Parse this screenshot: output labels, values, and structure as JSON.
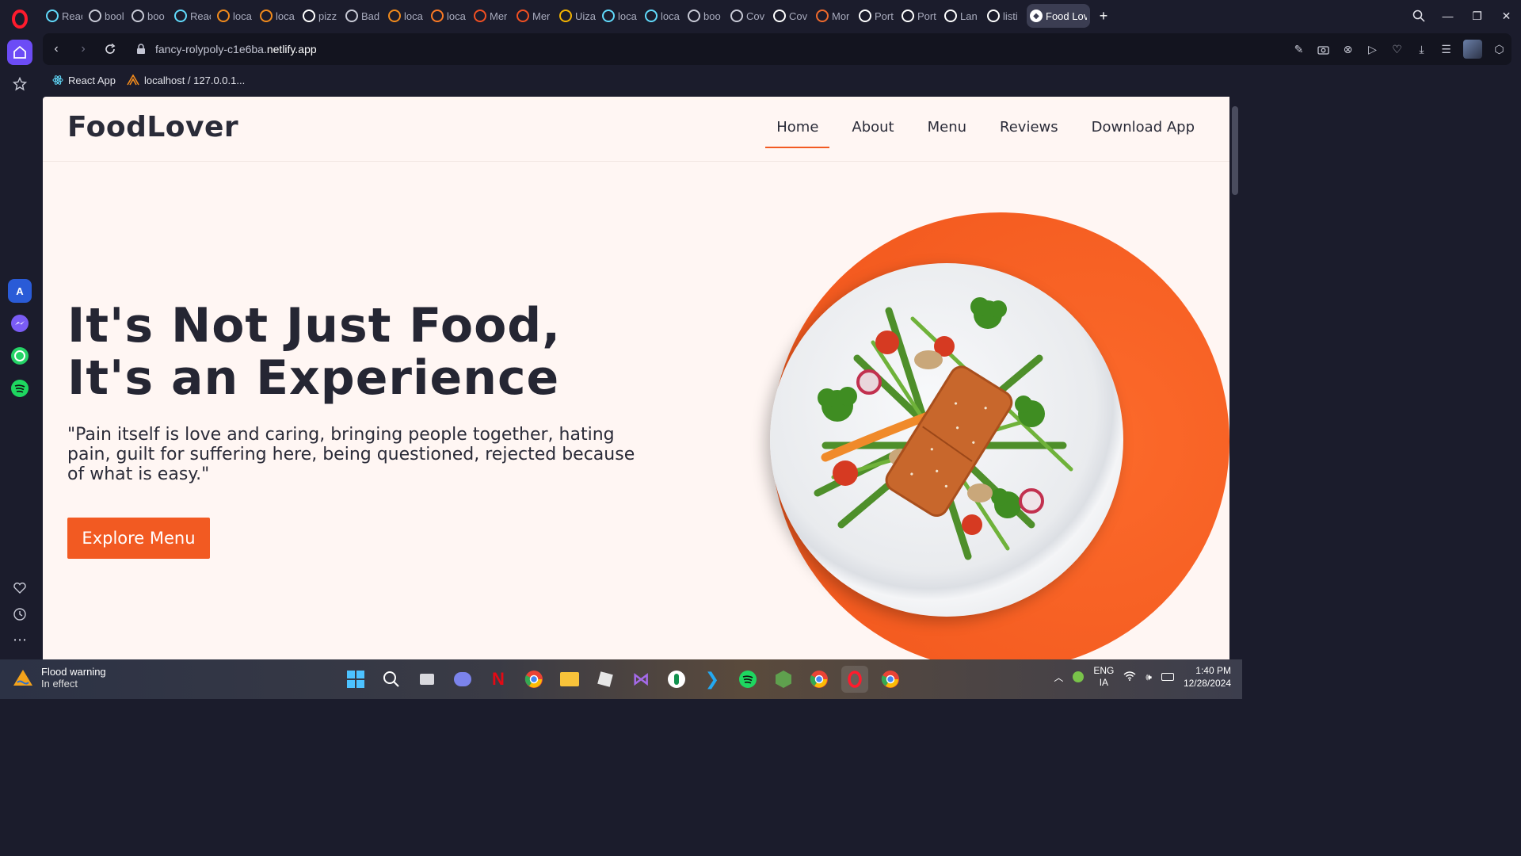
{
  "browser": {
    "tabs": [
      {
        "label": "Reac",
        "icon": "react-icon",
        "color": "#61dafb"
      },
      {
        "label": "bool",
        "icon": "page-icon",
        "color": "#c8cad6"
      },
      {
        "label": "boo",
        "icon": "page-icon",
        "color": "#c8cad6"
      },
      {
        "label": "Reac",
        "icon": "react-icon",
        "color": "#61dafb"
      },
      {
        "label": "loca",
        "icon": "xampp-icon",
        "color": "#f28b1c"
      },
      {
        "label": "loca",
        "icon": "xampp-icon",
        "color": "#f28b1c"
      },
      {
        "label": "pizz",
        "icon": "google-icon",
        "color": "#ffffff"
      },
      {
        "label": "Bad",
        "icon": "page-icon",
        "color": "#c8cad6"
      },
      {
        "label": "loca",
        "icon": "xampp-icon",
        "color": "#f28b1c"
      },
      {
        "label": "loca",
        "icon": "xampp-x-icon",
        "color": "#fb7a24"
      },
      {
        "label": "Mer",
        "icon": "microsoft-icon",
        "color": "#f25022"
      },
      {
        "label": "Mer",
        "icon": "microsoft-icon",
        "color": "#f25022"
      },
      {
        "label": "Uiza",
        "icon": "uiza-icon",
        "color": "#f5b400"
      },
      {
        "label": "loca",
        "icon": "react-icon",
        "color": "#61dafb"
      },
      {
        "label": "loca",
        "icon": "react-icon",
        "color": "#61dafb"
      },
      {
        "label": "boo",
        "icon": "page-icon",
        "color": "#c8cad6"
      },
      {
        "label": "Cov",
        "icon": "page-icon",
        "color": "#c8cad6"
      },
      {
        "label": "Cov",
        "icon": "netlify-icon",
        "color": "#ffffff"
      },
      {
        "label": "Mor",
        "icon": "mon-icon",
        "color": "#f06a2c"
      },
      {
        "label": "Port",
        "icon": "netlify-icon",
        "color": "#ffffff"
      },
      {
        "label": "Port",
        "icon": "netlify-icon",
        "color": "#ffffff"
      },
      {
        "label": "Lan",
        "icon": "netlify-icon",
        "color": "#ffffff"
      },
      {
        "label": "listi",
        "icon": "netlify-icon",
        "color": "#ffffff"
      }
    ],
    "active_tab": {
      "label": "Food Lov",
      "icon": "netlify-icon"
    },
    "new_tab": "+",
    "url_prefix": "fancy-rolypoly-c1e6ba.",
    "url_domain": "netlify.app",
    "bookmarks": [
      {
        "label": "React App",
        "icon": "react-icon"
      },
      {
        "label": "localhost / 127.0.0.1...",
        "icon": "xampp-icon"
      }
    ]
  },
  "site": {
    "brand": "FoodLover",
    "nav": [
      "Home",
      "About",
      "Menu",
      "Reviews",
      "Download App"
    ],
    "active_nav": "Home",
    "hero_line1": "It's Not Just Food,",
    "hero_line2": "It's an Experience",
    "quote": "\"Pain itself is love and caring, bringing people together, hating pain, guilt for suffering here, being questioned, rejected because of what is easy.\"",
    "cta": "Explore Menu",
    "accent_color": "#f25a22"
  },
  "taskbar": {
    "notif_title": "Flood warning",
    "notif_sub": "In effect",
    "lang1": "ENG",
    "lang2": "IA",
    "time": "1:40 PM",
    "date": "12/28/2024"
  }
}
